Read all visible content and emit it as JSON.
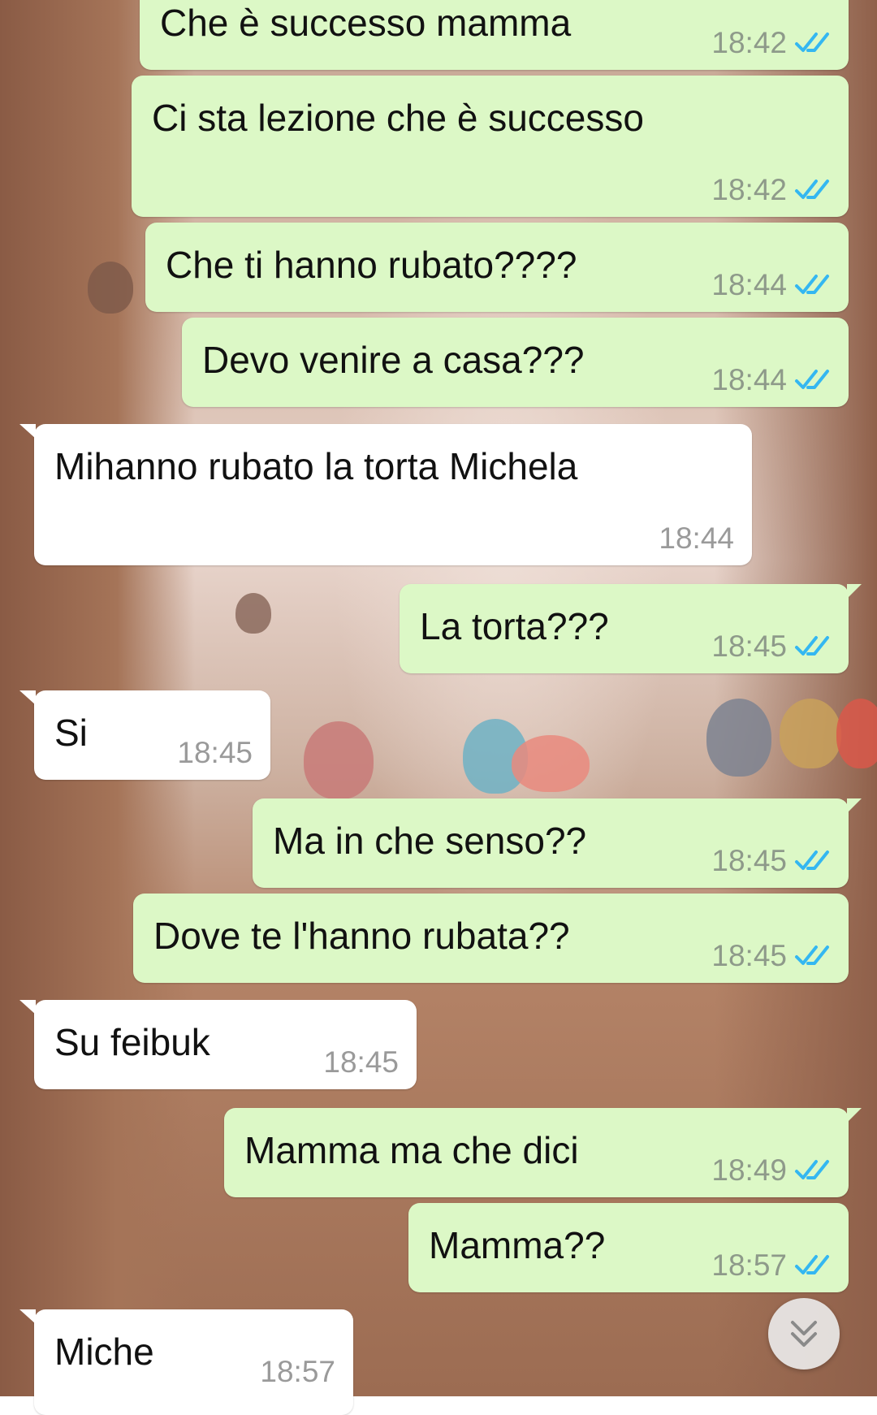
{
  "messages": [
    {
      "text": "Che è successo mamma",
      "time": "18:42",
      "status": "read"
    },
    {
      "text": "Ci sta lezione che è successo",
      "time": "18:42",
      "status": "read"
    },
    {
      "text": "Che ti hanno rubato????",
      "time": "18:44",
      "status": "read"
    },
    {
      "text": "Devo venire a casa???",
      "time": "18:44",
      "status": "read"
    },
    {
      "text": "Mihanno rubato la torta Michela",
      "time": "18:44"
    },
    {
      "text": "La torta???",
      "time": "18:45",
      "status": "read"
    },
    {
      "text": "Si",
      "time": "18:45"
    },
    {
      "text": "Ma in che senso??",
      "time": "18:45",
      "status": "read"
    },
    {
      "text": "Dove te l'hanno rubata??",
      "time": "18:45",
      "status": "read"
    },
    {
      "text": "Su feibuk",
      "time": "18:45"
    },
    {
      "text": "Mamma ma che dici",
      "time": "18:49",
      "status": "read"
    },
    {
      "text": "Mamma??",
      "time": "18:57",
      "status": "read"
    },
    {
      "text": "Miche",
      "time": "18:57"
    }
  ],
  "icons": {
    "read_receipt": "double-check-icon",
    "scroll_down": "chevron-double-down-icon"
  },
  "colors": {
    "outgoing_bubble": "#dcf8c6",
    "incoming_bubble": "#ffffff",
    "read_tick": "#34b7f1"
  }
}
